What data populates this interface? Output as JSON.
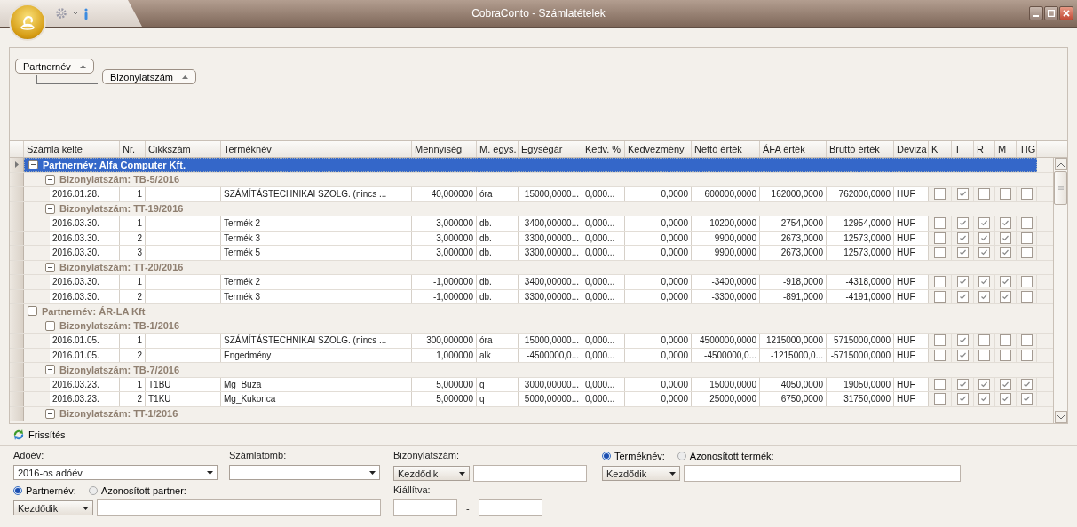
{
  "window": {
    "title": "CobraConto - Számlatételek"
  },
  "group_by": [
    {
      "label": "Partnernév"
    },
    {
      "label": "Bizonylatszám"
    }
  ],
  "table": {
    "columns": [
      "Számla kelte",
      "Nr.",
      "Cikkszám",
      "Terméknév",
      "Mennyiség",
      "M. egys.",
      "Egységár",
      "Kedv. %",
      "Kedvezmény",
      "Nettó érték",
      "ÁFA érték",
      "Bruttó érték",
      "Deviza",
      "K",
      "T",
      "R",
      "M",
      "TIG"
    ],
    "groups": [
      {
        "label": "Partnernév: Alfa Computer Kft.",
        "selected": true,
        "expanded": true,
        "children": [
          {
            "label": "Bizonylatszám: TB-5/2016",
            "selected": false,
            "expanded": true,
            "rows": [
              {
                "cells": [
                  "2016.01.28.",
                  "1",
                  "",
                  "SZÁMÍTÁSTECHNIKAI SZOLG. (nincs ...",
                  "40,000000",
                  "óra",
                  "15000,0000...",
                  "0,000...",
                  "0,0000",
                  "600000,0000",
                  "162000,0000",
                  "762000,0000",
                  "HUF"
                ],
                "flags": [
                  false,
                  true,
                  false,
                  false,
                  false
                ]
              }
            ]
          },
          {
            "label": "Bizonylatszám: TT-19/2016",
            "selected": false,
            "expanded": true,
            "rows": [
              {
                "cells": [
                  "2016.03.30.",
                  "1",
                  "",
                  "Termék 2",
                  "3,000000",
                  "db.",
                  "3400,00000...",
                  "0,000...",
                  "0,0000",
                  "10200,0000",
                  "2754,0000",
                  "12954,0000",
                  "HUF"
                ],
                "flags": [
                  false,
                  true,
                  true,
                  true,
                  false
                ]
              },
              {
                "cells": [
                  "2016.03.30.",
                  "2",
                  "",
                  "Termék 3",
                  "3,000000",
                  "db.",
                  "3300,00000...",
                  "0,000...",
                  "0,0000",
                  "9900,0000",
                  "2673,0000",
                  "12573,0000",
                  "HUF"
                ],
                "flags": [
                  false,
                  true,
                  true,
                  true,
                  false
                ]
              },
              {
                "cells": [
                  "2016.03.30.",
                  "3",
                  "",
                  "Termék 5",
                  "3,000000",
                  "db.",
                  "3300,00000...",
                  "0,000...",
                  "0,0000",
                  "9900,0000",
                  "2673,0000",
                  "12573,0000",
                  "HUF"
                ],
                "flags": [
                  false,
                  true,
                  true,
                  true,
                  false
                ]
              }
            ]
          },
          {
            "label": "Bizonylatszám: TT-20/2016",
            "selected": false,
            "expanded": true,
            "rows": [
              {
                "cells": [
                  "2016.03.30.",
                  "1",
                  "",
                  "Termék 2",
                  "-1,000000",
                  "db.",
                  "3400,00000...",
                  "0,000...",
                  "0,0000",
                  "-3400,0000",
                  "-918,0000",
                  "-4318,0000",
                  "HUF"
                ],
                "flags": [
                  false,
                  true,
                  true,
                  true,
                  false
                ]
              },
              {
                "cells": [
                  "2016.03.30.",
                  "2",
                  "",
                  "Termék 3",
                  "-1,000000",
                  "db.",
                  "3300,00000...",
                  "0,000...",
                  "0,0000",
                  "-3300,0000",
                  "-891,0000",
                  "-4191,0000",
                  "HUF"
                ],
                "flags": [
                  false,
                  true,
                  true,
                  true,
                  false
                ]
              }
            ]
          }
        ]
      },
      {
        "label": "Partnernév: ÁR-LA Kft",
        "selected": false,
        "expanded": true,
        "children": [
          {
            "label": "Bizonylatszám: TB-1/2016",
            "selected": false,
            "expanded": true,
            "rows": [
              {
                "cells": [
                  "2016.01.05.",
                  "1",
                  "",
                  "SZÁMÍTÁSTECHNIKAI SZOLG. (nincs ...",
                  "300,000000",
                  "óra",
                  "15000,0000...",
                  "0,000...",
                  "0,0000",
                  "4500000,0000",
                  "1215000,0000",
                  "5715000,0000",
                  "HUF"
                ],
                "flags": [
                  false,
                  true,
                  false,
                  false,
                  false
                ]
              },
              {
                "cells": [
                  "2016.01.05.",
                  "2",
                  "",
                  "Engedmény",
                  "1,000000",
                  "alk",
                  "-4500000,0...",
                  "0,000...",
                  "0,0000",
                  "-4500000,0...",
                  "-1215000,0...",
                  "-5715000,0000",
                  "HUF"
                ],
                "flags": [
                  false,
                  true,
                  false,
                  false,
                  false
                ]
              }
            ]
          },
          {
            "label": "Bizonylatszám: TB-7/2016",
            "selected": false,
            "expanded": true,
            "rows": [
              {
                "cells": [
                  "2016.03.23.",
                  "1",
                  "T1BU",
                  "Mg_Búza",
                  "5,000000",
                  "q",
                  "3000,00000...",
                  "0,000...",
                  "0,0000",
                  "15000,0000",
                  "4050,0000",
                  "19050,0000",
                  "HUF"
                ],
                "flags": [
                  false,
                  true,
                  true,
                  true,
                  true
                ]
              },
              {
                "cells": [
                  "2016.03.23.",
                  "2",
                  "T1KU",
                  "Mg_Kukorica",
                  "5,000000",
                  "q",
                  "5000,00000...",
                  "0,000...",
                  "0,0000",
                  "25000,0000",
                  "6750,0000",
                  "31750,0000",
                  "HUF"
                ],
                "flags": [
                  false,
                  true,
                  true,
                  true,
                  true
                ]
              }
            ]
          },
          {
            "label": "Bizonylatszám: TT-1/2016",
            "selected": false,
            "expanded": true
          }
        ]
      }
    ]
  },
  "refresh_button": {
    "label": "Frissítés"
  },
  "filters": {
    "tax_year": {
      "label": "Adóév:",
      "value": "2016-os adóév"
    },
    "invoice_block": {
      "label": "Számlatömb:"
    },
    "document_number": {
      "label": "Bizonylatszám:",
      "mode": "Kezdődik"
    },
    "product_options": [
      {
        "label": "Terméknév:",
        "selected": true
      },
      {
        "label": "Azonosított termék:",
        "selected": false
      }
    ],
    "product": {
      "mode": "Kezdődik"
    },
    "partner_options": [
      {
        "label": "Partnernév:",
        "selected": true
      },
      {
        "label": "Azonosított partner:",
        "selected": false
      }
    ],
    "partner": {
      "mode": "Kezdődik"
    },
    "issued": {
      "label": "Kiállítva:",
      "separator": "-"
    }
  }
}
